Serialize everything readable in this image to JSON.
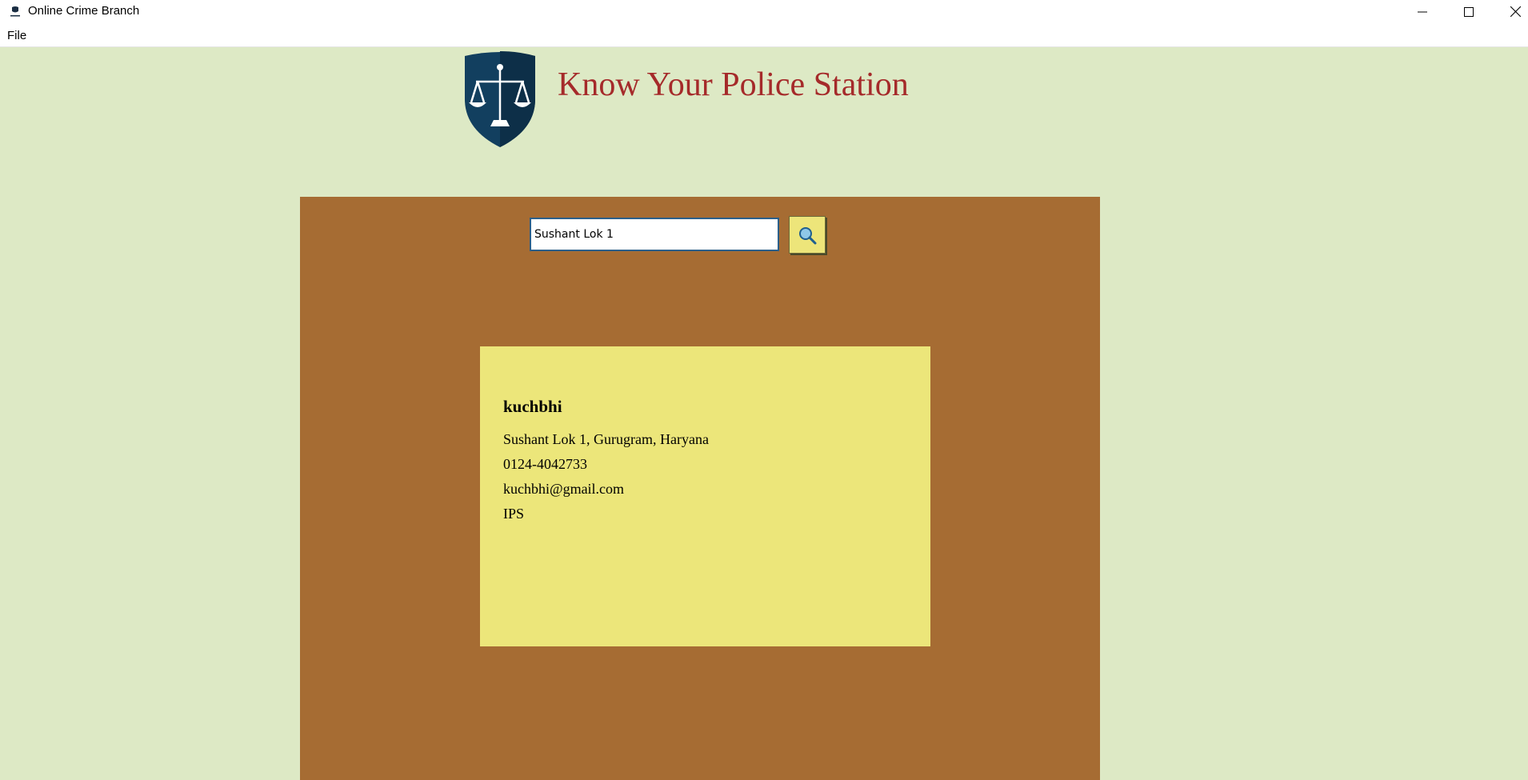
{
  "window": {
    "title": "Online Crime Branch",
    "minimize_icon": "minimize-icon",
    "maximize_icon": "maximize-icon",
    "close_icon": "close-icon"
  },
  "menu": {
    "items": [
      "File"
    ]
  },
  "header": {
    "title": "Know Your Police Station",
    "logo_icon": "scales-of-justice-shield-icon"
  },
  "search": {
    "value": "Sushant Lok 1",
    "button_icon": "search-icon"
  },
  "result": {
    "name": "kuchbhi",
    "address": "Sushant Lok 1, Gurugram, Haryana",
    "phone": "0124-4042733",
    "email": "kuchbhi@gmail.com",
    "rank": "IPS"
  },
  "colors": {
    "background": "#dde9c5",
    "panel": "#a66c33",
    "card": "#ece67a",
    "heading": "#a52a2a",
    "logo_shield": "#123f5f"
  }
}
